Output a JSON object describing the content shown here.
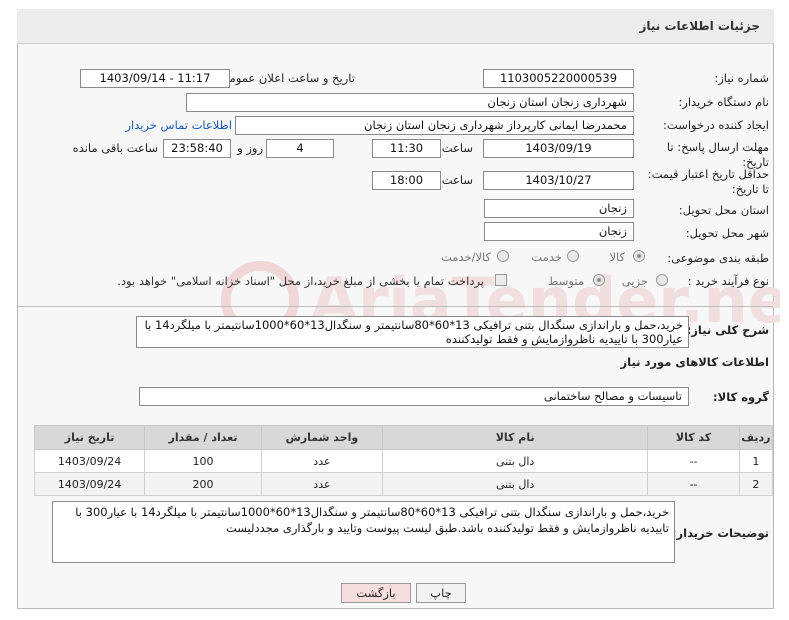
{
  "header": {
    "title": "جزئیات اطلاعات نیاز"
  },
  "fields": {
    "need_number_label": "شماره نیاز:",
    "need_number": "1103005220000539",
    "announce_label": "تاریخ و ساعت اعلان عمومی:",
    "announce_value": "1403/09/14 - 11:17",
    "buyer_org_label": "نام دستگاه خریدار:",
    "buyer_org": "شهرداری زنجان استان زنجان",
    "requester_label": "ایجاد کننده درخواست:",
    "requester": "محمدرضا  ایمانی کارپرداز شهرداری زنجان استان زنجان",
    "contact_link": "اطلاعات تماس خریدار",
    "reply_deadline_label": "مهلت ارسال پاسخ: تا تاریخ:",
    "reply_date": "1403/09/19",
    "time_label": "ساعت",
    "reply_time": "11:30",
    "days_value": "4",
    "days_label": "روز و",
    "remaining_value": "23:58:40",
    "remaining_label": "ساعت باقی مانده",
    "validity_label": "حداقل تاریخ اعتبار قیمت: تا تاریخ:",
    "validity_date": "1403/10/27",
    "validity_time": "18:00",
    "province_label": "استان محل تحویل:",
    "province": "زنجان",
    "city_label": "شهر محل تحویل:",
    "city": "زنجان",
    "category_label": "طبقه بندی موضوعی:",
    "category_options": [
      "کالا",
      "خدمت",
      "کالا/خدمت"
    ],
    "process_label": "نوع فرآیند خرید :",
    "process_options": [
      "جزیی",
      "متوسط"
    ],
    "payment_note": "پرداخت تمام یا بخشی از مبلغ خرید،از محل \"اسناد خزانه اسلامی\" خواهد بود."
  },
  "summary": {
    "label": "شرح کلی نیاز:",
    "text": "خرید،حمل و باراندازی سنگدال بتنی ترافیکی 13*60*80سانتیمتر و سنگدال13*60*1000سانتیمتر با میلگرد14 با عیار300 با تاییدیه ناظروازمایش و فقط تولیدکننده"
  },
  "goods_section": {
    "title": "اطلاعات کالاهای مورد نیاز",
    "group_label": "گروه کالا:",
    "group_value": "تاسیسات و مصالح ساختمانی"
  },
  "table": {
    "headers": [
      "ردیف",
      "کد کالا",
      "نام کالا",
      "واحد شمارش",
      "تعداد / مقدار",
      "تاریخ نیاز"
    ],
    "rows": [
      [
        "1",
        "--",
        "دال بتنی",
        "عدد",
        "100",
        "1403/09/24"
      ],
      [
        "2",
        "--",
        "دال بتنی",
        "عدد",
        "200",
        "1403/09/24"
      ]
    ]
  },
  "buyer_notes": {
    "label": "توضیحات خریدار:",
    "text": "خرید،حمل و باراندازی سنگدال بتنی ترافیکی 13*60*80سانتیمتر و سنگدال13*60*1000سانتیمتر با میلگرد14 با عیار300 با تاییدیه ناظروازمایش و فقط تولیدکننده باشد.طبق لیست پیوست وتایید و بارگذاری مجددلیست"
  },
  "buttons": {
    "print": "چاپ",
    "back": "بازگشت"
  },
  "colors": {
    "link": "#1b58b8",
    "back_button": "#f7dede",
    "table_header": "#d8d8d8"
  }
}
